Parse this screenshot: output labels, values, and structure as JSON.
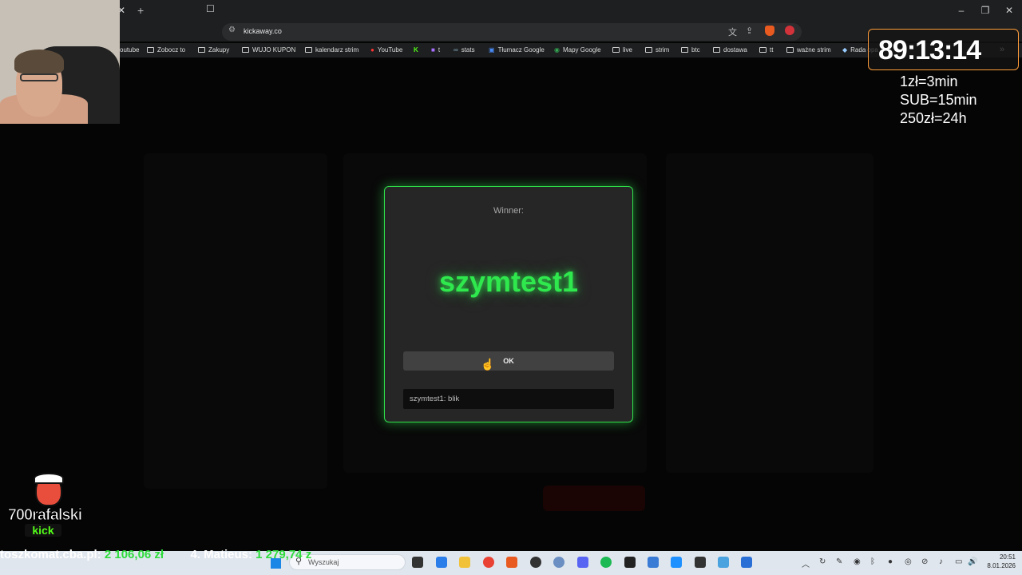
{
  "browser": {
    "url": "kickaway.co",
    "bookmarks": [
      "outube",
      "Zobocz to",
      "Zakupy",
      "WUJO KUPON",
      "kalendarz strim",
      "YouTube",
      "t",
      "stats",
      "Tłumacz Google",
      "Mapy Google",
      "live",
      "strim",
      "btc",
      "dostawa",
      "tt",
      "ważne strim",
      "Rada opa"
    ]
  },
  "modal": {
    "winner_label": "Winner:",
    "winner_name": "szymtest1",
    "ok_label": "OK",
    "message": "szymtest1: blik"
  },
  "overlay": {
    "timer": "89:13:14",
    "rates": [
      "1zł=3min",
      "SUB=15min",
      "250zł=24h"
    ],
    "logo_text": "700rafalski",
    "logo_kick": "kick",
    "ticker_site": "toszkomat.cba.pl:",
    "ticker_amount1": "2 106,06 zł",
    "ticker_rank": "4. Matieus:",
    "ticker_amount2": "1 279,74 z"
  },
  "taskbar": {
    "search_placeholder": "Wyszukaj",
    "time": "20:51",
    "date": "8.01.2026"
  },
  "colors": {
    "accent_green": "#2fe84d",
    "timer_border": "#ff9d3a"
  }
}
